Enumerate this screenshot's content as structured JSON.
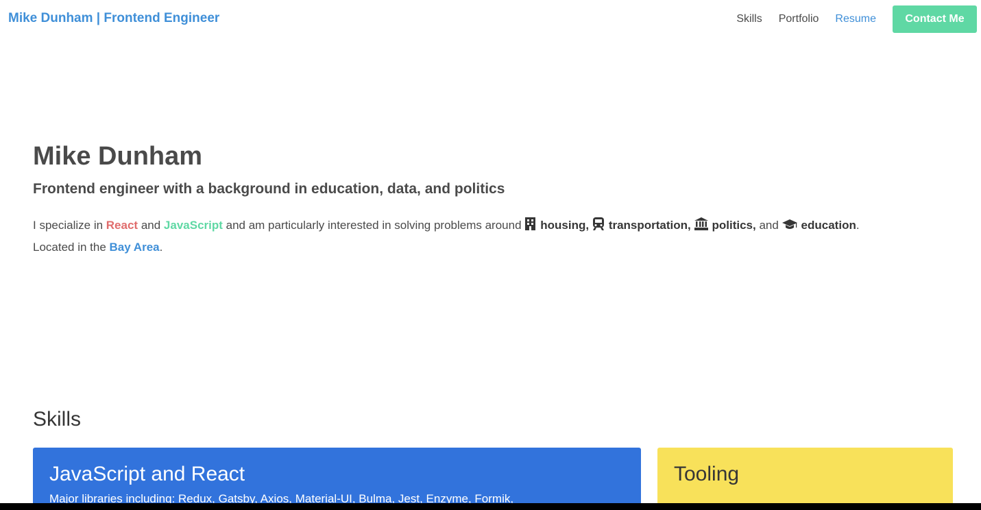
{
  "navbar": {
    "brand": "Mike Dunham | Frontend Engineer",
    "links": [
      {
        "label": "Skills"
      },
      {
        "label": "Portfolio"
      },
      {
        "label": "Resume"
      }
    ],
    "contact_label": "Contact Me"
  },
  "hero": {
    "title": "Mike Dunham",
    "subtitle": "Frontend engineer with a background in education, data, and politics",
    "text": {
      "intro": "I specialize in ",
      "react": "React",
      "and1": " and ",
      "javascript": "JavaScript",
      "interest": " and am particularly interested in solving problems around ",
      "housing": "housing,",
      "transportation": "transportation,",
      "politics": "politics,",
      "and2": " and ",
      "education": "education",
      "located": ". Located in the ",
      "bay_area": "Bay Area",
      "period": "."
    }
  },
  "skills": {
    "heading": "Skills",
    "cards": [
      {
        "title": "JavaScript and React",
        "subtitle": "Major libraries including: Redux, Gatsby, Axios, Material-UI, Bulma, Jest, Enzyme, Formik,"
      },
      {
        "title": "Tooling",
        "subtitle": ""
      }
    ]
  },
  "icons": {
    "housing": "building-icon",
    "transportation": "train-icon",
    "politics": "landmark-icon",
    "education": "graduation-cap-icon"
  },
  "colors": {
    "brand": "#3f8fd8",
    "contact_button": "#5fd8a4",
    "react": "#e06c6c",
    "javascript": "#5fd8a4",
    "bay_area": "#3f8fd8",
    "card_js": "#3273dc",
    "card_tooling": "#f8e15a"
  }
}
